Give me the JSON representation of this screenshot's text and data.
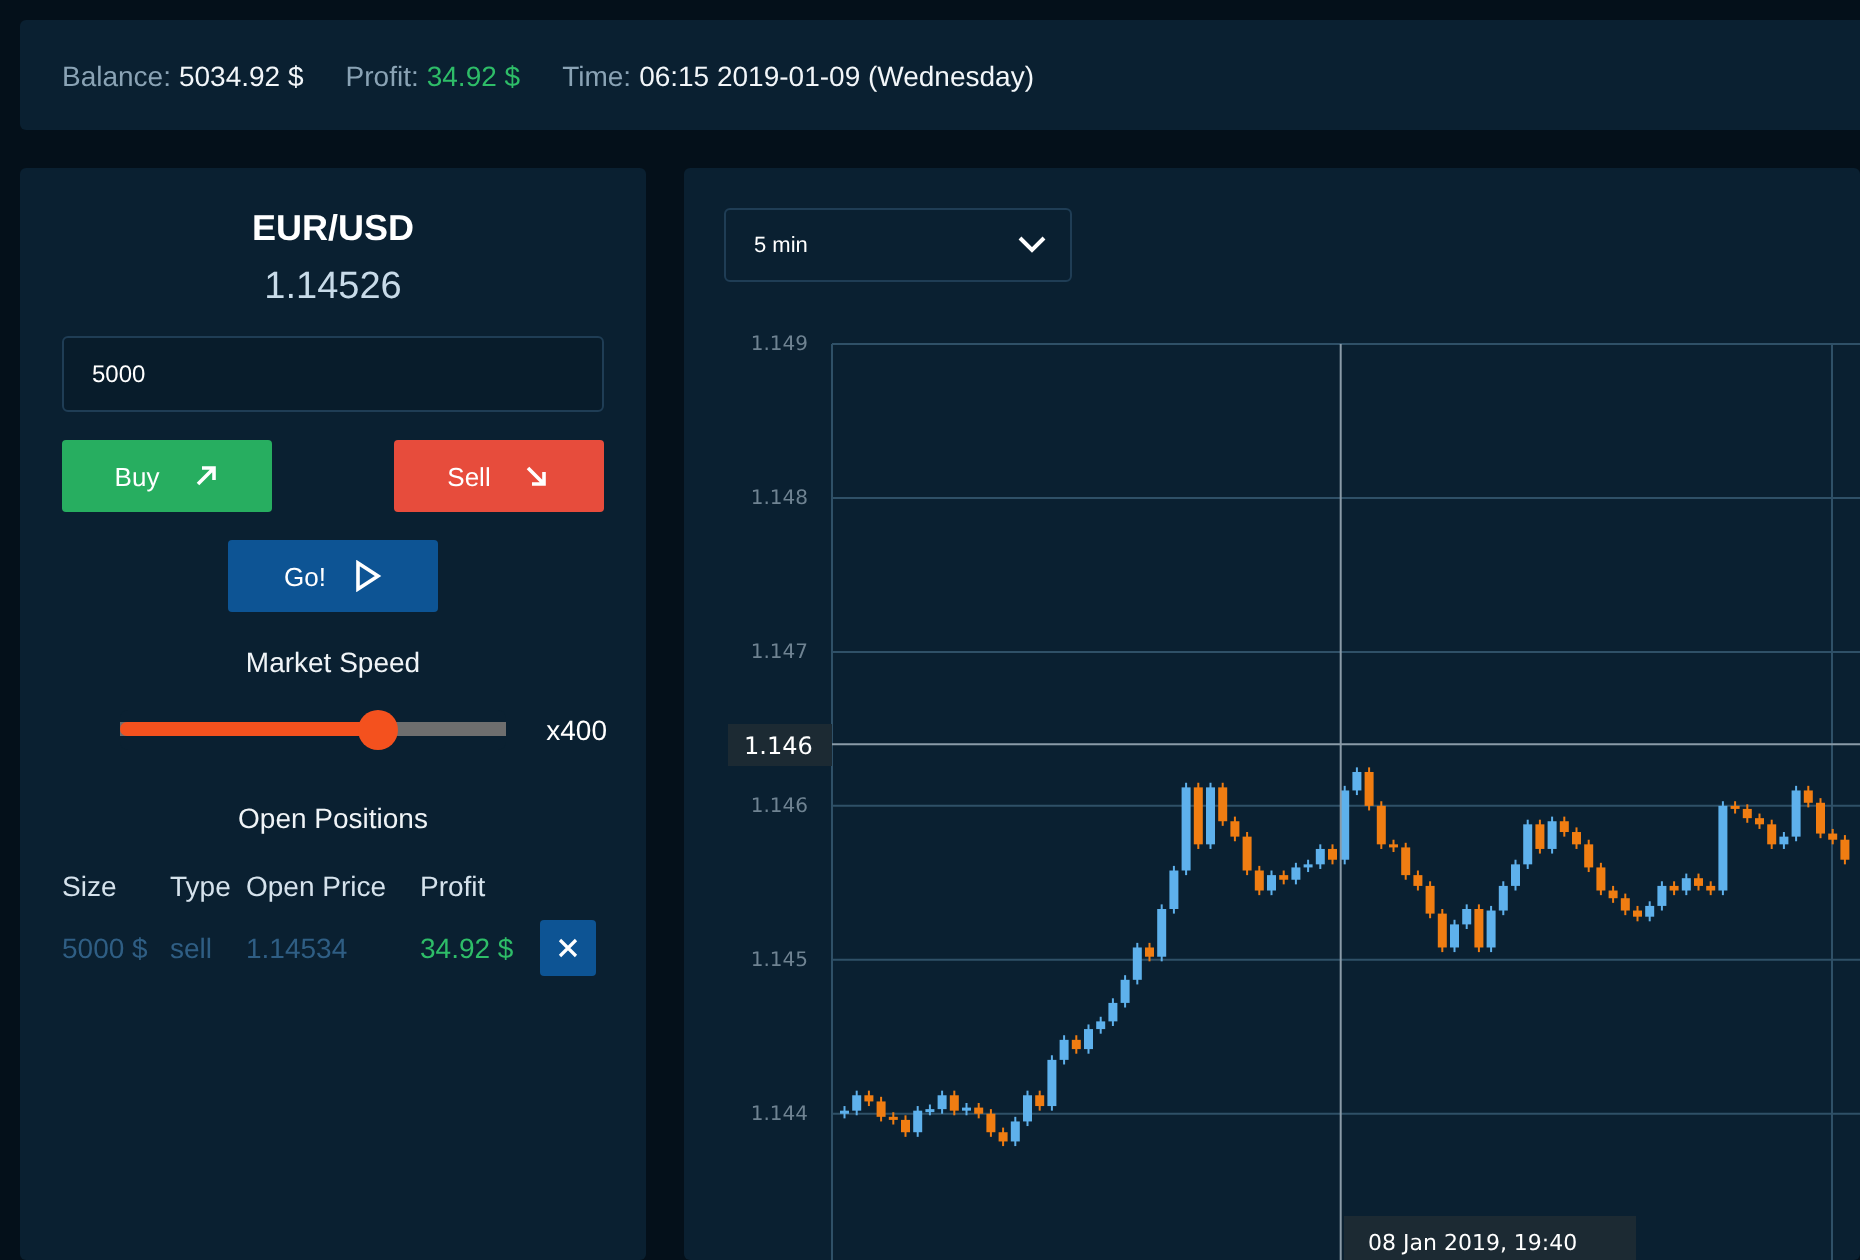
{
  "top_bar": {
    "stats": [
      {
        "kind": "plain",
        "label": "Balance:",
        "value": "5034.92 $"
      },
      {
        "kind": "gain",
        "label": "Profit:",
        "value": "34.92 $"
      },
      {
        "kind": "plain",
        "label": "Time:",
        "value": "06:15 2019-01-09 (Wednesday)"
      }
    ]
  },
  "trade_panel": {
    "pair": "EUR/USD",
    "price": "1.14526",
    "amount": "5000",
    "buttons": [
      {
        "kind": "buy",
        "label": "Buy"
      },
      {
        "kind": "sell",
        "label": "Sell"
      }
    ],
    "go_button": "Go!",
    "speed": {
      "label": "Market Speed",
      "level": 0.667,
      "reading": "x400"
    },
    "positions": {
      "title": "Open Positions",
      "columns": [
        "Size",
        "Type",
        "Open Price",
        "Profit"
      ],
      "rows": [
        {
          "size": "5000 $",
          "type": "sell",
          "open_price": "1.14534",
          "profit": "34.92 $"
        }
      ]
    }
  },
  "chart": {
    "timeframe": "5 min",
    "crosshair_price": "1.146",
    "crosshair_time": "08 Jan 2019, 19:40",
    "chart_data": {
      "type": "candlestick",
      "grid": true,
      "ylim": [
        1.14305,
        1.149
      ],
      "yticks": [
        1.149,
        1.148,
        1.147,
        1.146,
        1.145,
        1.144
      ],
      "ref_lines": [
        {
          "axis": "y",
          "value": 1.1464
        }
      ],
      "ohlc": [
        [
          1.144,
          1.14405,
          1.14397,
          1.14402
        ],
        [
          1.14402,
          1.14415,
          1.14399,
          1.14412
        ],
        [
          1.14412,
          1.14415,
          1.14405,
          1.14408
        ],
        [
          1.14408,
          1.14411,
          1.14395,
          1.14398
        ],
        [
          1.14398,
          1.14401,
          1.14393,
          1.14396
        ],
        [
          1.14396,
          1.14399,
          1.14385,
          1.14388
        ],
        [
          1.14388,
          1.14405,
          1.14385,
          1.14402
        ],
        [
          1.14402,
          1.14406,
          1.14399,
          1.14403
        ],
        [
          1.14403,
          1.14415,
          1.144,
          1.14412
        ],
        [
          1.14412,
          1.14415,
          1.14399,
          1.14402
        ],
        [
          1.14402,
          1.14407,
          1.14399,
          1.14404
        ],
        [
          1.14404,
          1.14407,
          1.14397,
          1.144
        ],
        [
          1.144,
          1.14403,
          1.14385,
          1.14388
        ],
        [
          1.14388,
          1.14391,
          1.14379,
          1.14382
        ],
        [
          1.14382,
          1.14398,
          1.14379,
          1.14395
        ],
        [
          1.14395,
          1.14415,
          1.14392,
          1.14412
        ],
        [
          1.14412,
          1.14415,
          1.14402,
          1.14405
        ],
        [
          1.14405,
          1.14438,
          1.14402,
          1.14435
        ],
        [
          1.14435,
          1.14451,
          1.14432,
          1.14448
        ],
        [
          1.14448,
          1.14451,
          1.14439,
          1.14442
        ],
        [
          1.14442,
          1.14458,
          1.14439,
          1.14455
        ],
        [
          1.14455,
          1.14463,
          1.14452,
          1.1446
        ],
        [
          1.1446,
          1.14475,
          1.14457,
          1.14472
        ],
        [
          1.14472,
          1.1449,
          1.14469,
          1.14487
        ],
        [
          1.14487,
          1.14511,
          1.14484,
          1.14508
        ],
        [
          1.14508,
          1.14511,
          1.14499,
          1.14502
        ],
        [
          1.14502,
          1.14536,
          1.14499,
          1.14533
        ],
        [
          1.14533,
          1.14561,
          1.1453,
          1.14558
        ],
        [
          1.14558,
          1.14615,
          1.14555,
          1.14612
        ],
        [
          1.14612,
          1.14615,
          1.14572,
          1.14575
        ],
        [
          1.14575,
          1.14615,
          1.14572,
          1.14612
        ],
        [
          1.14612,
          1.14615,
          1.14587,
          1.1459
        ],
        [
          1.1459,
          1.14593,
          1.14577,
          1.1458
        ],
        [
          1.1458,
          1.14583,
          1.14555,
          1.14558
        ],
        [
          1.14558,
          1.14561,
          1.14542,
          1.14545
        ],
        [
          1.14545,
          1.14558,
          1.14542,
          1.14555
        ],
        [
          1.14555,
          1.14558,
          1.14549,
          1.14552
        ],
        [
          1.14552,
          1.14563,
          1.14549,
          1.1456
        ],
        [
          1.1456,
          1.14565,
          1.14557,
          1.14562
        ],
        [
          1.14562,
          1.14575,
          1.14559,
          1.14572
        ],
        [
          1.14572,
          1.14575,
          1.14562,
          1.14565
        ],
        [
          1.14565,
          1.14613,
          1.14562,
          1.1461
        ],
        [
          1.1461,
          1.14625,
          1.14607,
          1.14622
        ],
        [
          1.14622,
          1.14625,
          1.14597,
          1.146
        ],
        [
          1.146,
          1.14603,
          1.14572,
          1.14575
        ],
        [
          1.14575,
          1.14578,
          1.1457,
          1.14573
        ],
        [
          1.14573,
          1.14576,
          1.14552,
          1.14555
        ],
        [
          1.14555,
          1.14558,
          1.14545,
          1.14548
        ],
        [
          1.14548,
          1.14551,
          1.14527,
          1.1453
        ],
        [
          1.1453,
          1.14533,
          1.14505,
          1.14508
        ],
        [
          1.14508,
          1.14526,
          1.14505,
          1.14523
        ],
        [
          1.14523,
          1.14536,
          1.1452,
          1.14533
        ],
        [
          1.14533,
          1.14536,
          1.14505,
          1.14508
        ],
        [
          1.14508,
          1.14535,
          1.14505,
          1.14532
        ],
        [
          1.14532,
          1.14551,
          1.14529,
          1.14548
        ],
        [
          1.14548,
          1.14565,
          1.14545,
          1.14562
        ],
        [
          1.14562,
          1.14591,
          1.14559,
          1.14588
        ],
        [
          1.14588,
          1.14591,
          1.14569,
          1.14572
        ],
        [
          1.14572,
          1.14593,
          1.14569,
          1.1459
        ],
        [
          1.1459,
          1.14593,
          1.1458,
          1.14583
        ],
        [
          1.14583,
          1.14586,
          1.14572,
          1.14575
        ],
        [
          1.14575,
          1.14578,
          1.14557,
          1.1456
        ],
        [
          1.1456,
          1.14563,
          1.14542,
          1.14545
        ],
        [
          1.14545,
          1.14548,
          1.14537,
          1.1454
        ],
        [
          1.1454,
          1.14543,
          1.14529,
          1.14532
        ],
        [
          1.14532,
          1.14535,
          1.14525,
          1.14528
        ],
        [
          1.14528,
          1.14538,
          1.14525,
          1.14535
        ],
        [
          1.14535,
          1.14551,
          1.14532,
          1.14548
        ],
        [
          1.14548,
          1.14551,
          1.14542,
          1.14545
        ],
        [
          1.14545,
          1.14556,
          1.14542,
          1.14553
        ],
        [
          1.14553,
          1.14556,
          1.14545,
          1.14548
        ],
        [
          1.14548,
          1.14551,
          1.14542,
          1.14545
        ],
        [
          1.14545,
          1.14603,
          1.14542,
          1.146
        ],
        [
          1.146,
          1.14603,
          1.14595,
          1.14598
        ],
        [
          1.14598,
          1.14601,
          1.14589,
          1.14592
        ],
        [
          1.14592,
          1.14595,
          1.14585,
          1.14588
        ],
        [
          1.14588,
          1.14591,
          1.14572,
          1.14575
        ],
        [
          1.14575,
          1.14583,
          1.14572,
          1.1458
        ],
        [
          1.1458,
          1.14613,
          1.14577,
          1.1461
        ],
        [
          1.1461,
          1.14613,
          1.14599,
          1.14602
        ],
        [
          1.14602,
          1.14605,
          1.14579,
          1.14582
        ],
        [
          1.14582,
          1.14585,
          1.14575,
          1.14578
        ],
        [
          1.14578,
          1.14581,
          1.14562,
          1.14565
        ]
      ]
    }
  }
}
